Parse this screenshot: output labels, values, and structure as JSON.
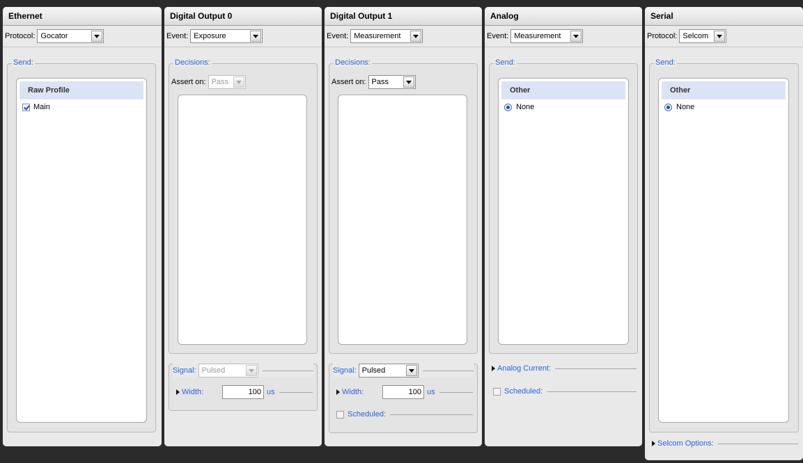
{
  "panels": {
    "ethernet": {
      "title": "Ethernet",
      "header_label": "Protocol:",
      "header_value": "Gocator",
      "send_legend": "Send:",
      "list_header": "Raw Profile",
      "items": [
        {
          "label": "Main",
          "checked": true
        }
      ]
    },
    "digital0": {
      "title": "Digital Output 0",
      "header_label": "Event:",
      "header_value": "Exposure",
      "decisions_legend": "Decisions:",
      "assert_label": "Assert on:",
      "assert_value": "Pass",
      "signal_label": "Signal:",
      "signal_value": "Pulsed",
      "width_label": "Width:",
      "width_value": "100",
      "width_unit": "us"
    },
    "digital1": {
      "title": "Digital Output 1",
      "header_label": "Event:",
      "header_value": "Measurement",
      "decisions_legend": "Decisions:",
      "assert_label": "Assert on:",
      "assert_value": "Pass",
      "signal_label": "Signal:",
      "signal_value": "Pulsed",
      "width_label": "Width:",
      "width_value": "100",
      "width_unit": "us",
      "scheduled_label": "Scheduled:"
    },
    "analog": {
      "title": "Analog",
      "header_label": "Event:",
      "header_value": "Measurement",
      "send_legend": "Send:",
      "list_header": "Other",
      "items": [
        {
          "label": "None",
          "selected": true
        }
      ],
      "analog_current_label": "Analog Current:",
      "scheduled_label": "Scheduled:"
    },
    "serial": {
      "title": "Serial",
      "header_label": "Protocol:",
      "header_value": "Selcom",
      "send_legend": "Send:",
      "list_header": "Other",
      "items": [
        {
          "label": "None",
          "selected": true
        }
      ],
      "selcom_options_label": "Selcom Options:"
    }
  },
  "colors": {
    "background": "#2b2b2b",
    "panel": "#e9e9e9",
    "accent_blue": "#2a64d8",
    "list_header": "#dbe4f5"
  }
}
